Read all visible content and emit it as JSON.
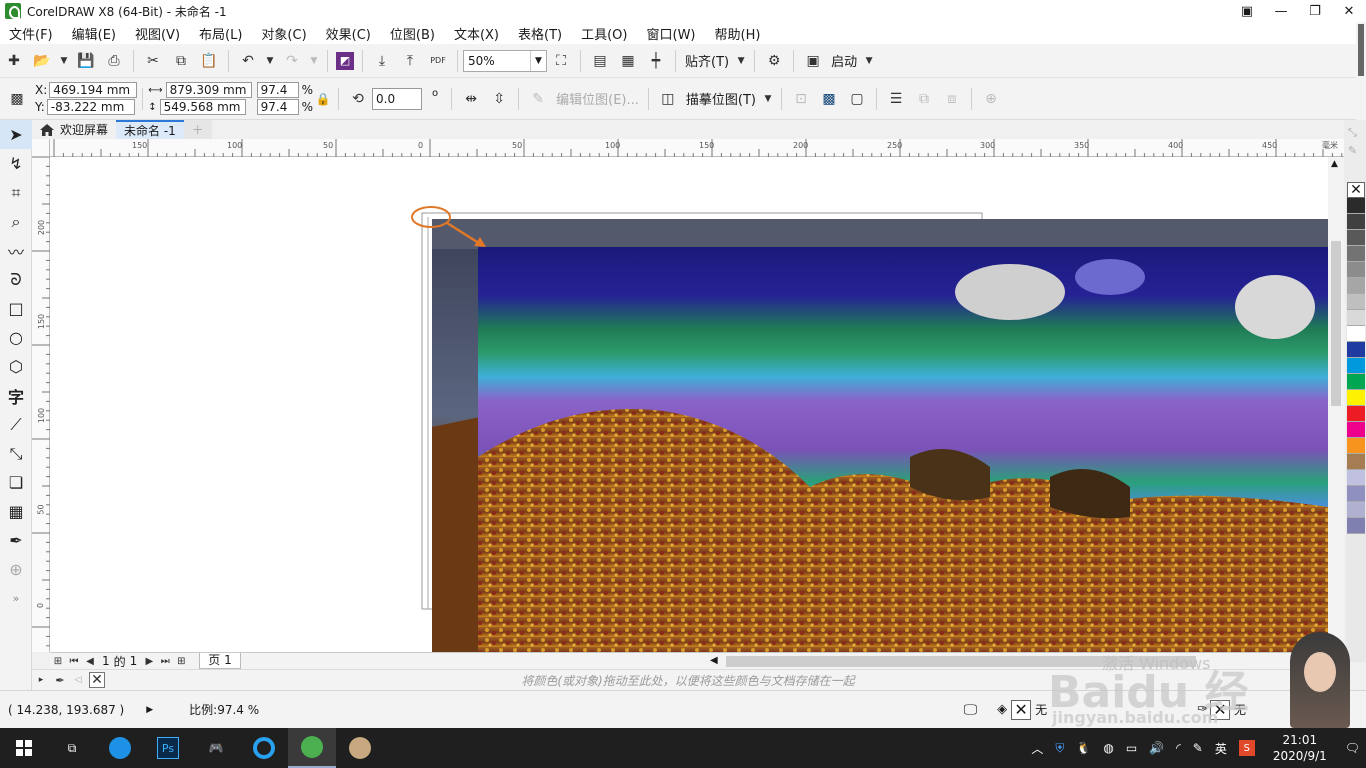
{
  "window": {
    "title": "CorelDRAW X8 (64-Bit) - 未命名 -1"
  },
  "menu": [
    "文件(F)",
    "编辑(E)",
    "视图(V)",
    "布局(L)",
    "对象(C)",
    "效果(C)",
    "位图(B)",
    "文本(X)",
    "表格(T)",
    "工具(O)",
    "窗口(W)",
    "帮助(H)"
  ],
  "toolbar1": {
    "zoom": "50%",
    "snap_label": "贴齐(T)",
    "launch_label": "启动",
    "pdf_label": "PDF"
  },
  "toolbar2": {
    "x_label": "X:",
    "x_value": "469.194 mm",
    "y_label": "Y:",
    "y_value": "-83.222 mm",
    "w_value": "879.309 mm",
    "h_value": "549.568 mm",
    "sx_value": "97.4",
    "sy_value": "97.4",
    "pct": "%",
    "rotate_value": "0.0",
    "deg": "o",
    "edit_bitmap": "编辑位图(E)...",
    "trace_bitmap": "描摹位图(T)"
  },
  "tabs": [
    {
      "label": "欢迎屏幕"
    },
    {
      "label": "未命名 -1"
    }
  ],
  "ruler": {
    "h_ticks": [
      "150",
      "100",
      "50",
      "0",
      "50",
      "100",
      "150",
      "200",
      "250",
      "300",
      "350",
      "400",
      "450"
    ],
    "h_unit": "毫米",
    "v_ticks": [
      "200",
      "150",
      "100",
      "50",
      "0"
    ]
  },
  "pagenav": {
    "current": "1",
    "of": "的",
    "total": "1",
    "page_tab": "页 1"
  },
  "docpalette": {
    "hint": "将颜色(或对象)拖动至此处，以便将这些颜色与文档存储在一起"
  },
  "status": {
    "coords": "( 14.238, 193.687 )",
    "scale": "比例:97.4 %",
    "fill_none": "无",
    "outline_none": "无"
  },
  "palette": [
    "#2b2b2b",
    "#404040",
    "#595959",
    "#737373",
    "#8c8c8c",
    "#a6a6a6",
    "#bfbfbf",
    "#d9d9d9",
    "#ffffff",
    "#1f3aa0",
    "#0099dd",
    "#00a651",
    "#fff200",
    "#ed1c24",
    "#ec008c",
    "#f7941d",
    "#a67c52",
    "#c0c0e0",
    "#9090c0",
    "#b0b0d0",
    "#8080b0"
  ],
  "taskbar": {
    "time": "21:01",
    "date": "2020/9/1",
    "ime": "英"
  },
  "watermark": {
    "line1": "Baidu 经验",
    "line2": "jingyan.baidu.com",
    "activate": "激活 Windows"
  }
}
